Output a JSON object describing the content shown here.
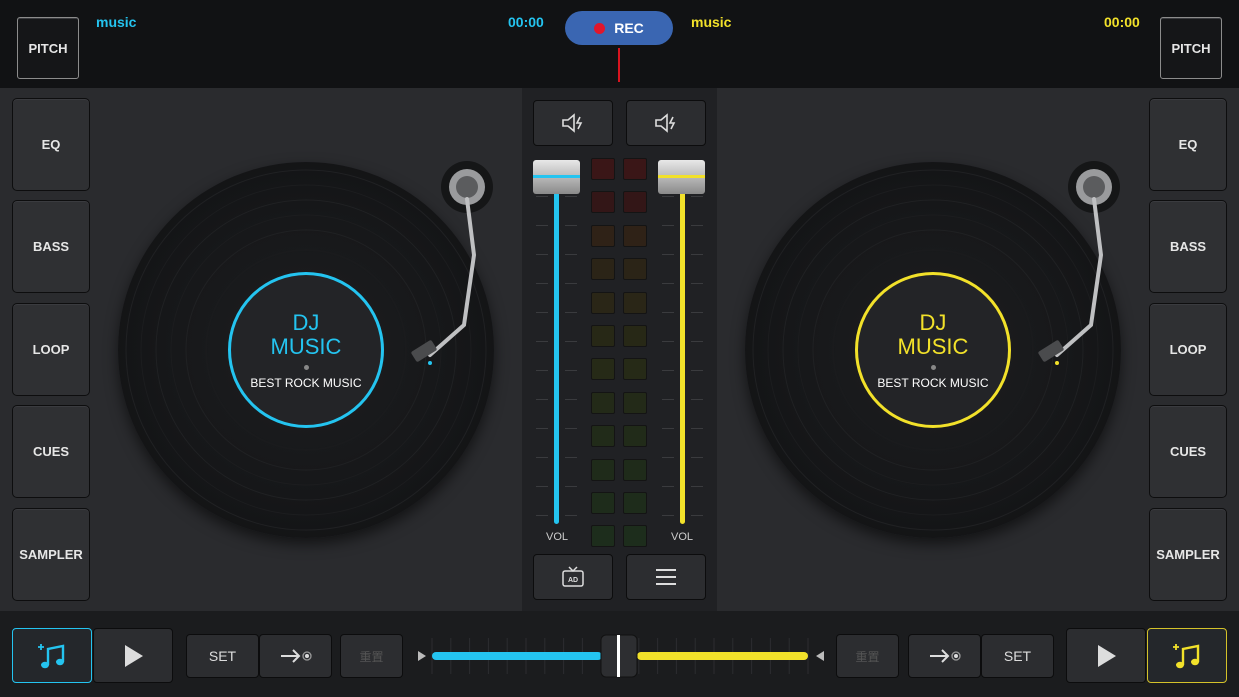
{
  "left_deck": {
    "pitch_label": "PITCH",
    "track_name": "music",
    "time": "00:00",
    "accent": "#24c4f0",
    "effects": [
      "EQ",
      "BASS",
      "LOOP",
      "CUES",
      "SAMPLER"
    ],
    "disc": {
      "title_line1": "DJ",
      "title_line2": "MUSIC",
      "subtitle": "BEST ROCK MUSIC"
    },
    "set_label": "SET",
    "set_icon": "arrow-right-dot-icon",
    "reset_label": "重置",
    "music_icon": "music-add-icon",
    "play_icon": "play-icon"
  },
  "right_deck": {
    "pitch_label": "PITCH",
    "track_name": "music",
    "time": "00:00",
    "accent": "#f2e12a",
    "effects": [
      "EQ",
      "BASS",
      "LOOP",
      "CUES",
      "SAMPLER"
    ],
    "disc": {
      "title_line1": "DJ",
      "title_line2": "MUSIC",
      "subtitle": "BEST ROCK MUSIC"
    },
    "set_label": "SET",
    "set_icon": "arrow-right-dot-icon",
    "reset_label": "重置",
    "music_icon": "music-add-icon",
    "play_icon": "play-icon"
  },
  "record": {
    "label": "REC",
    "color": "#3a66b2"
  },
  "mixer": {
    "vol_label_left": "VOL",
    "vol_label_right": "VOL",
    "left_volume": 1.0,
    "right_volume": 1.0,
    "speaker_icon": "speaker-icon",
    "ad_icon": "ad-tv-icon",
    "menu_icon": "menu-icon"
  },
  "crossfader": {
    "position": 0.5
  }
}
